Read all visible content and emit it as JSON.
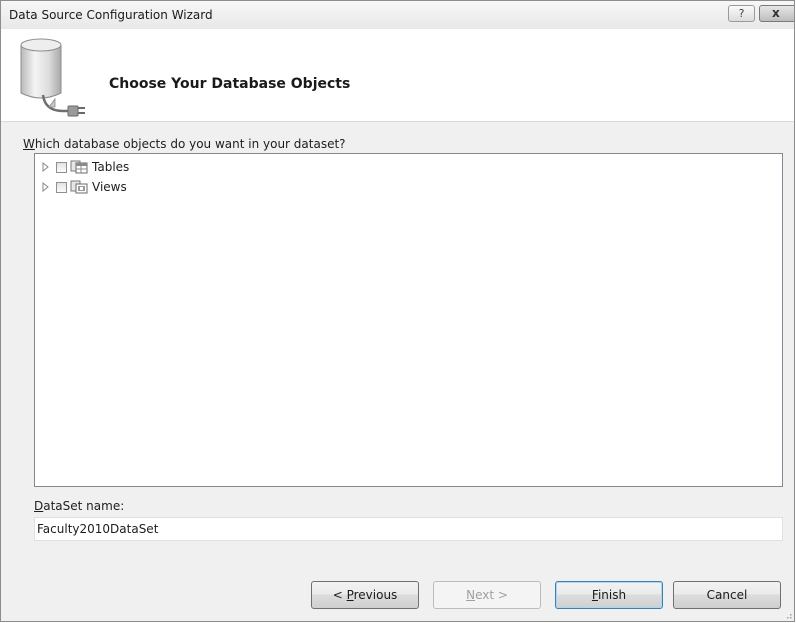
{
  "window": {
    "title": "Data Source Configuration Wizard",
    "help_label": "?",
    "close_label": "x"
  },
  "header": {
    "title": "Choose Your Database Objects",
    "icon": "database-icon"
  },
  "prompt": {
    "mnemonic": "W",
    "rest": "hich database objects do you want in your dataset?"
  },
  "tree": {
    "nodes": [
      {
        "label": "Tables",
        "checked": false,
        "icon": "tables-icon"
      },
      {
        "label": "Views",
        "checked": false,
        "icon": "views-icon"
      }
    ]
  },
  "dataset": {
    "label_mnemonic": "D",
    "label_rest": "ataSet name:",
    "value": "Faculty2010DataSet"
  },
  "buttons": {
    "previous": {
      "pre": "< ",
      "mnemonic": "P",
      "rest": "revious"
    },
    "next": {
      "mnemonic": "N",
      "rest": "ext >",
      "enabled": false
    },
    "finish": {
      "mnemonic": "F",
      "rest": "inish"
    },
    "cancel": {
      "label": "Cancel"
    }
  }
}
